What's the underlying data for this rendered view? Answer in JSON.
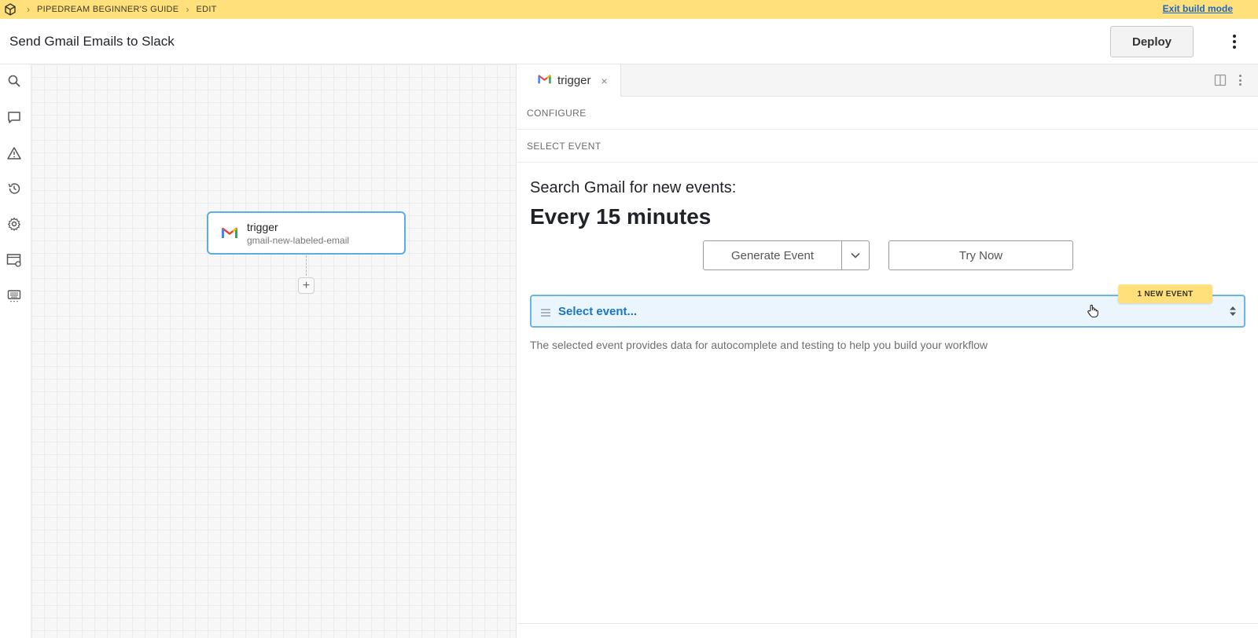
{
  "banner": {
    "breadcrumbs": [
      "PIPEDREAM BEGINNER'S GUIDE",
      "EDIT"
    ],
    "exit_label": "Exit build mode"
  },
  "header": {
    "title": "Send Gmail Emails to Slack",
    "deploy_label": "Deploy"
  },
  "sidebar": {
    "items": [
      {
        "icon": "search-icon"
      },
      {
        "icon": "comment-icon"
      },
      {
        "icon": "warning-icon"
      },
      {
        "icon": "history-icon"
      },
      {
        "icon": "gear-icon"
      },
      {
        "icon": "window-settings-icon"
      },
      {
        "icon": "keyboard-icon"
      }
    ]
  },
  "canvas": {
    "node": {
      "title": "trigger",
      "subtitle": "gmail-new-labeled-email",
      "icon": "gmail-icon"
    },
    "add_step_label": "+"
  },
  "panel": {
    "tab": {
      "label": "trigger",
      "close": "×"
    },
    "configure_label": "CONFIGURE",
    "select_event_label": "SELECT EVENT",
    "search_text": "Search Gmail for new events:",
    "interval": "Every 15 minutes",
    "generate_label": "Generate Event",
    "try_label": "Try Now",
    "select_placeholder": "Select event...",
    "badge": "1 NEW EVENT",
    "helper": "The selected event provides data for autocomplete and testing to help you build your workflow"
  },
  "colors": {
    "banner": "#ffe07a",
    "accent_blue": "#1c74c4",
    "node_border": "#5aaee6"
  }
}
